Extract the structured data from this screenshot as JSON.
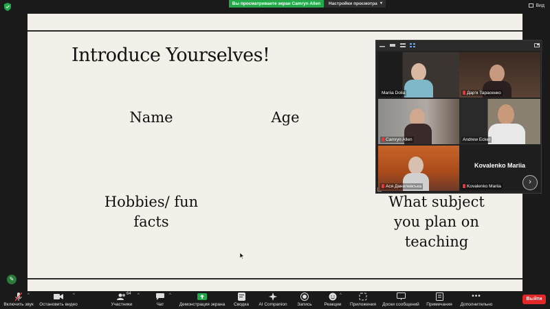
{
  "topbar": {
    "share_banner": "Вы просматриваете экран Camryn Allen",
    "view_options": "Настройки просмотра",
    "view_button": "Вид",
    "icons": [
      "shield-icon",
      "chevron-down-icon",
      "view-icon"
    ],
    "banner_color": "#23a84a"
  },
  "slide": {
    "title": "Introduce Yourselves!",
    "labels": {
      "name": "Name",
      "age": "Age",
      "hobbies_line1": "Hobbies/ fun",
      "hobbies_line2": "facts",
      "subject_line1": "What subject",
      "subject_line2": "you plan on",
      "subject_line3": "teaching"
    },
    "background": "#f3efe9"
  },
  "gallery": {
    "participants": [
      {
        "name": "Mariia Dolia",
        "muted": false,
        "active": true
      },
      {
        "name": "Дар'я Тарасенко",
        "muted": true
      },
      {
        "name": "Camryn Allen",
        "muted": true
      },
      {
        "name": "Andrew Ecker",
        "muted": false
      },
      {
        "name": "Ася Данилевська",
        "muted": true
      },
      {
        "name": "Kovalenko Mariia",
        "muted": true,
        "video_off_name": "Kovalenko Mariia"
      }
    ],
    "active_color": "#d8e86a"
  },
  "toolbar": {
    "unmute": "Включить звук",
    "stop_video": "Остановить видео",
    "participants": "Участники",
    "participants_count": "64",
    "chat": "Чат",
    "share_screen": "Демонстрация экрана",
    "summary": "Сводка",
    "ai_companion": "AI Companion",
    "record": "Запись",
    "reactions": "Реакции",
    "apps": "Приложения",
    "whiteboards": "Доски сообщений",
    "notes": "Примечания",
    "more": "Дополнительно",
    "leave": "Выйти",
    "leave_color": "#e02828",
    "share_color": "#23a84a"
  }
}
